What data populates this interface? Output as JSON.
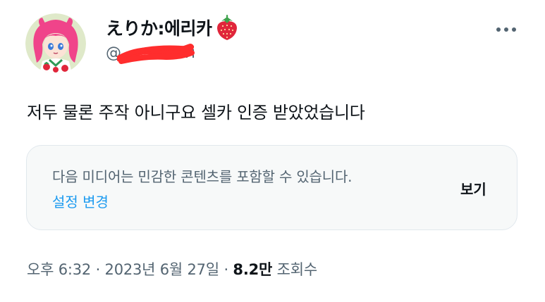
{
  "user": {
    "display_name": "えりか:에리카",
    "name_emoji_icon": "strawberry-icon",
    "handle_prefix": "@",
    "handle_suffix": "ri"
  },
  "tweet": {
    "text": "저두 물론 주작 아니구요 셀카 인증 받았었습니다"
  },
  "media_warning": {
    "message": "다음 미디어는 민감한 콘텐츠를 포함할 수 있습니다.",
    "settings_link": "설정 변경",
    "show_button": "보기"
  },
  "meta": {
    "time": "오후 6:32",
    "separator": "·",
    "date": "2023년 6월 27일",
    "views_count": "8.2만",
    "views_label": "조회수"
  },
  "colors": {
    "text_primary": "#0f1419",
    "text_secondary": "#536471",
    "link": "#1d9bf0",
    "card_bg": "#f7f9f9",
    "card_border": "#e1e8ed",
    "redaction": "#ff2d2d"
  }
}
